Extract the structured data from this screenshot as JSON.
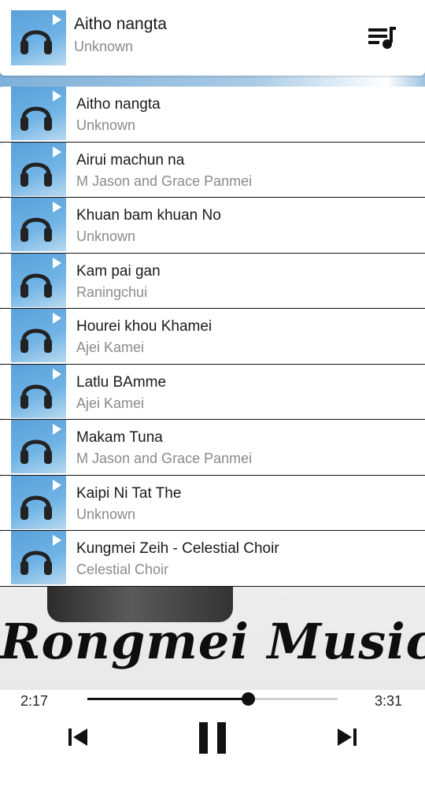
{
  "now_playing": {
    "title": "Aitho nangta",
    "artist": "Unknown"
  },
  "icons": {
    "queue": "queue-music-icon",
    "play_badge": "play-icon",
    "prev": "skip-previous-icon",
    "pause": "pause-icon",
    "next": "skip-next-icon",
    "art": "headphones-icon"
  },
  "songs": [
    {
      "title": "Aitho nangta",
      "artist": "Unknown"
    },
    {
      "title": "Airui machun na",
      "artist": "M Jason and Grace Panmei"
    },
    {
      "title": "Khuan bam khuan No",
      "artist": "Unknown"
    },
    {
      "title": "Kam pai gan",
      "artist": "Raningchui"
    },
    {
      "title": "Hourei khou Khamei",
      "artist": "Ajei Kamei"
    },
    {
      "title": "Latlu BAmme",
      "artist": "Ajei Kamei"
    },
    {
      "title": "Makam Tuna",
      "artist": "M Jason and Grace Panmei"
    },
    {
      "title": "Kaipi Ni Tat The",
      "artist": "Unknown"
    },
    {
      "title": "Kungmei Zeih - Celestial Choir",
      "artist": "Celestial Choir"
    }
  ],
  "brand_text": "Rongmei Music",
  "player": {
    "elapsed": "2:17",
    "total": "3:31",
    "progress": 0.64
  },
  "colors": {
    "accent": "#111111",
    "secondary_text": "#8a8a8a",
    "art_blue": "#6fb3e6"
  }
}
